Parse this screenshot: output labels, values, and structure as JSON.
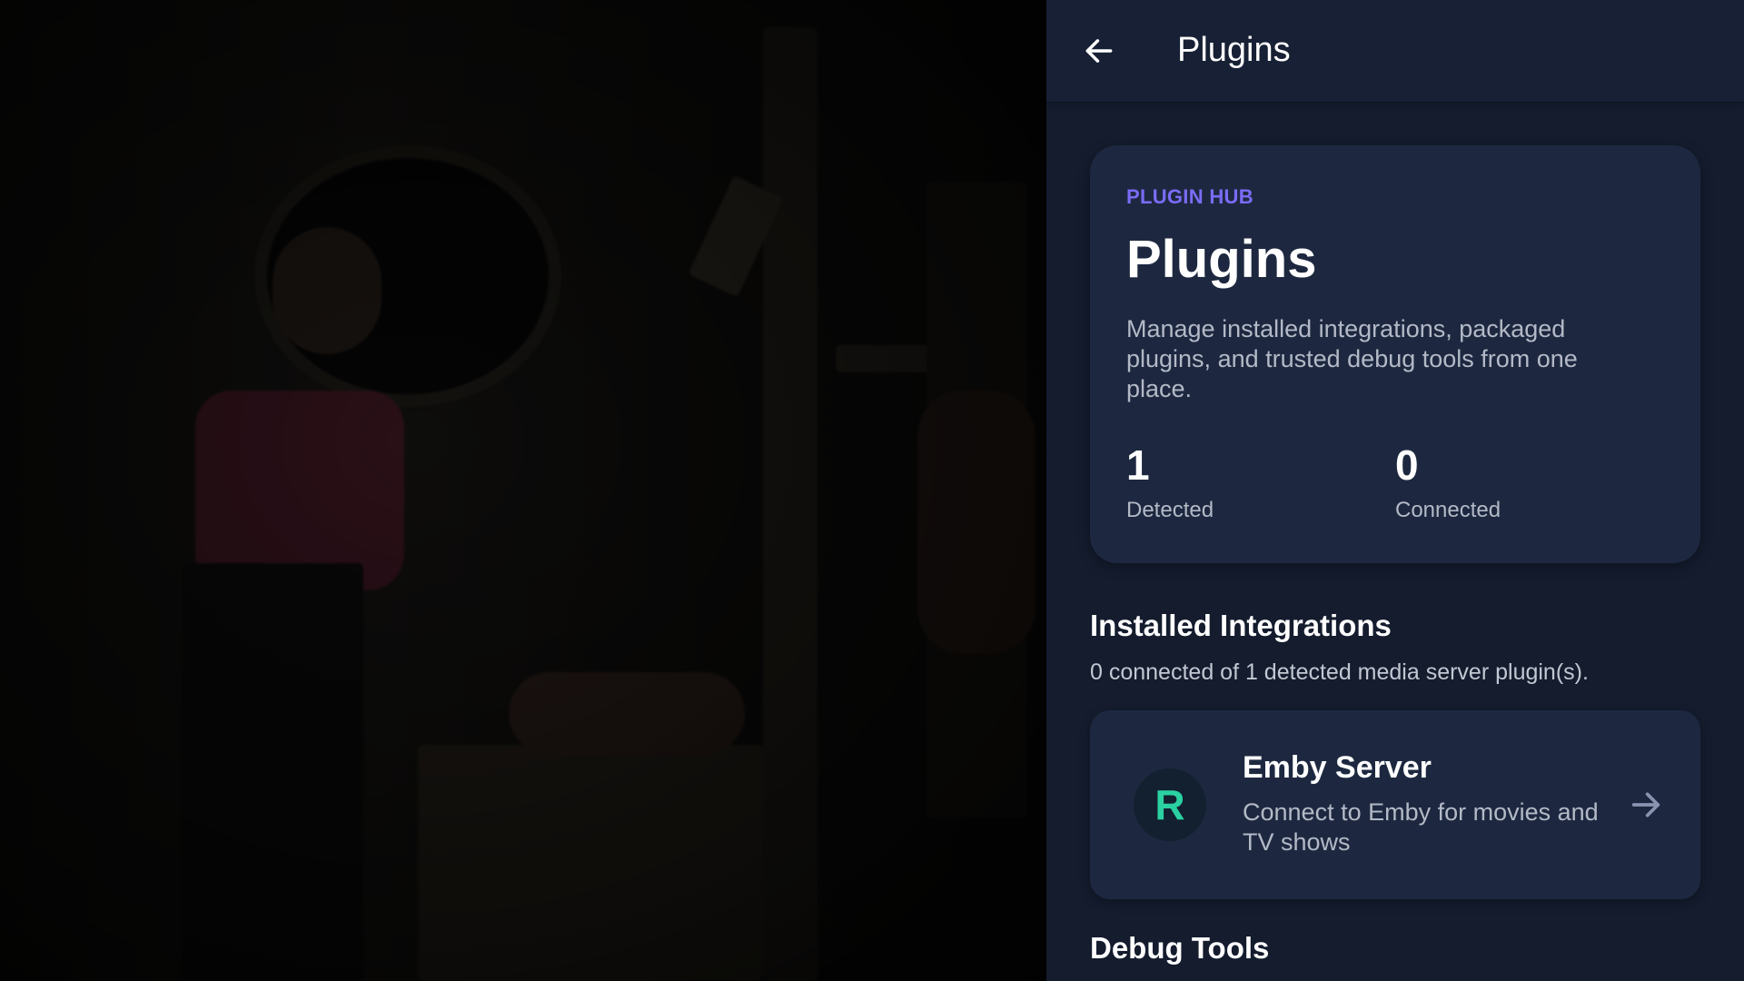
{
  "topbar": {
    "title": "Plugins"
  },
  "hub": {
    "eyebrow": "PLUGIN HUB",
    "title": "Plugins",
    "description": "Manage installed integrations, packaged plugins, and trusted debug tools from one place.",
    "stats": [
      {
        "value": "1",
        "label": "Detected"
      },
      {
        "value": "0",
        "label": "Connected"
      }
    ]
  },
  "installed": {
    "title": "Installed Integrations",
    "subtitle": "0 connected of 1 detected media server plugin(s).",
    "plugins": [
      {
        "avatar_letter": "R",
        "name": "Emby Server",
        "description": "Connect to Emby for movies and TV shows",
        "icon": "arrow-right-icon"
      }
    ]
  },
  "debug": {
    "title": "Debug Tools"
  },
  "colors": {
    "panel_bg": "#141c2e",
    "card_bg": "#1d2840",
    "accent": "#7b6cf6",
    "avatar_letter": "#2bd1a1"
  },
  "icons": {
    "back": "arrow-left-icon"
  }
}
